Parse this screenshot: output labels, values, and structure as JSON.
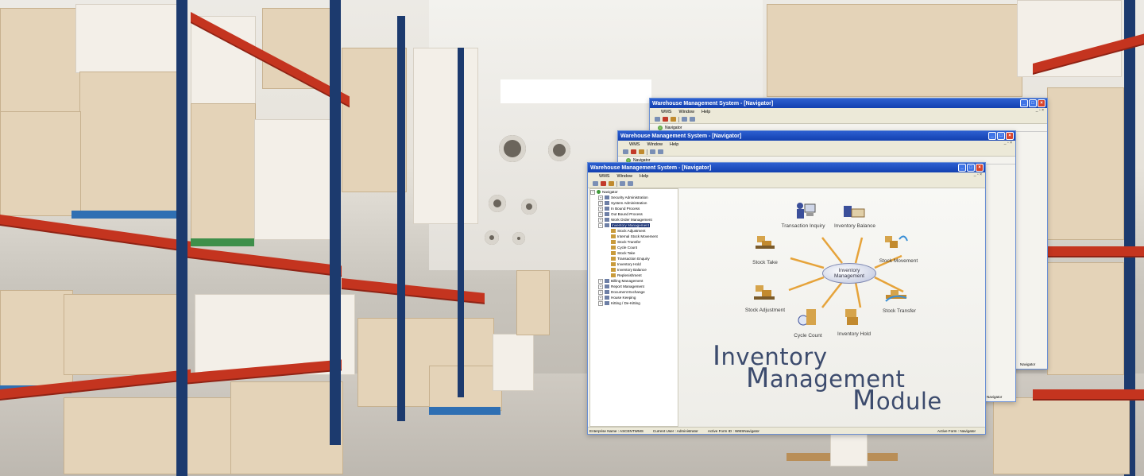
{
  "windows": {
    "title": "Warehouse Management System - [Navigator]",
    "menu": [
      "WMS",
      "Window",
      "Help"
    ],
    "nav_tab": "Navigator",
    "back_status": "Navigator"
  },
  "tree": {
    "root": "Navigator",
    "items": [
      {
        "label": "Security Administration",
        "level": 1
      },
      {
        "label": "System Administration",
        "level": 1
      },
      {
        "label": "In Bound Process",
        "level": 1
      },
      {
        "label": "Out Bound Process",
        "level": 1
      },
      {
        "label": "Work Order Management",
        "level": 1
      },
      {
        "label": "Inventory Management",
        "level": 1,
        "selected": true
      },
      {
        "label": "Stock Adjustment",
        "level": 2
      },
      {
        "label": "Internal Stock Movement",
        "level": 2
      },
      {
        "label": "Stock Transfer",
        "level": 2
      },
      {
        "label": "Cycle Count",
        "level": 2
      },
      {
        "label": "Stock Take",
        "level": 2
      },
      {
        "label": "Transaction Enquiry",
        "level": 2
      },
      {
        "label": "Inventory Hold",
        "level": 2
      },
      {
        "label": "Inventory Balance",
        "level": 2
      },
      {
        "label": "Replenishment",
        "level": 2
      },
      {
        "label": "Billing Management",
        "level": 1
      },
      {
        "label": "Report Management",
        "level": 1
      },
      {
        "label": "Document Exchange",
        "level": 1
      },
      {
        "label": "House Keeping",
        "level": 1
      },
      {
        "label": "Kitting / De-Kitting",
        "level": 1
      }
    ]
  },
  "diagram": {
    "center": "Inventory Management",
    "nodes": {
      "transaction_inquiry": "Transaction Inquiry",
      "inventory_balance": "Inventory Balance",
      "stock_take": "Stock Take",
      "stock_movement": "Stock Movement",
      "stock_adjustment": "Stock Adjustment",
      "stock_transfer": "Stock Transfer",
      "cycle_count": "Cycle Count",
      "inventory_hold": "Inventory Hold"
    },
    "title_line1_cap": "I",
    "title_line1_rest": "nventory",
    "title_line2_cap": "M",
    "title_line2_rest": "anagement",
    "title_line3_cap": "M",
    "title_line3_rest": "odule"
  },
  "status": {
    "enterprise": "Enterprise Name : ASCENTWMS",
    "user": "Current User : Administrator",
    "form_id": "Active Form ID : WMSNavigator",
    "active_form": "Active Form : Navigator"
  }
}
